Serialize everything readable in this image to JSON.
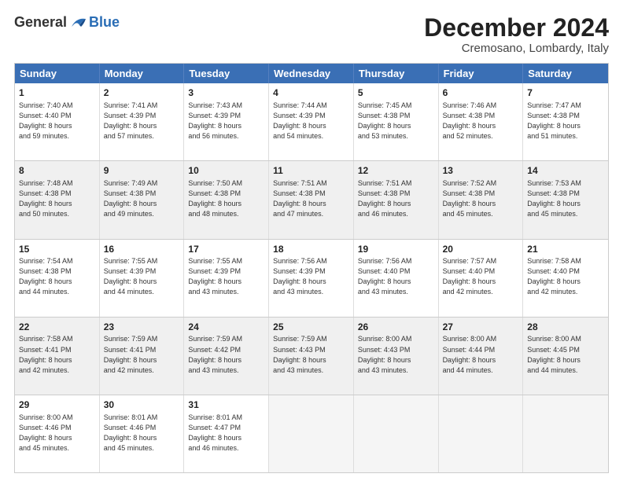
{
  "logo": {
    "general": "General",
    "blue": "Blue"
  },
  "title": "December 2024",
  "location": "Cremosano, Lombardy, Italy",
  "header_days": [
    "Sunday",
    "Monday",
    "Tuesday",
    "Wednesday",
    "Thursday",
    "Friday",
    "Saturday"
  ],
  "weeks": [
    [
      {
        "day": "1",
        "lines": [
          "Sunrise: 7:40 AM",
          "Sunset: 4:40 PM",
          "Daylight: 8 hours",
          "and 59 minutes."
        ],
        "shaded": false
      },
      {
        "day": "2",
        "lines": [
          "Sunrise: 7:41 AM",
          "Sunset: 4:39 PM",
          "Daylight: 8 hours",
          "and 57 minutes."
        ],
        "shaded": false
      },
      {
        "day": "3",
        "lines": [
          "Sunrise: 7:43 AM",
          "Sunset: 4:39 PM",
          "Daylight: 8 hours",
          "and 56 minutes."
        ],
        "shaded": false
      },
      {
        "day": "4",
        "lines": [
          "Sunrise: 7:44 AM",
          "Sunset: 4:39 PM",
          "Daylight: 8 hours",
          "and 54 minutes."
        ],
        "shaded": false
      },
      {
        "day": "5",
        "lines": [
          "Sunrise: 7:45 AM",
          "Sunset: 4:38 PM",
          "Daylight: 8 hours",
          "and 53 minutes."
        ],
        "shaded": false
      },
      {
        "day": "6",
        "lines": [
          "Sunrise: 7:46 AM",
          "Sunset: 4:38 PM",
          "Daylight: 8 hours",
          "and 52 minutes."
        ],
        "shaded": false
      },
      {
        "day": "7",
        "lines": [
          "Sunrise: 7:47 AM",
          "Sunset: 4:38 PM",
          "Daylight: 8 hours",
          "and 51 minutes."
        ],
        "shaded": false
      }
    ],
    [
      {
        "day": "8",
        "lines": [
          "Sunrise: 7:48 AM",
          "Sunset: 4:38 PM",
          "Daylight: 8 hours",
          "and 50 minutes."
        ],
        "shaded": true
      },
      {
        "day": "9",
        "lines": [
          "Sunrise: 7:49 AM",
          "Sunset: 4:38 PM",
          "Daylight: 8 hours",
          "and 49 minutes."
        ],
        "shaded": true
      },
      {
        "day": "10",
        "lines": [
          "Sunrise: 7:50 AM",
          "Sunset: 4:38 PM",
          "Daylight: 8 hours",
          "and 48 minutes."
        ],
        "shaded": true
      },
      {
        "day": "11",
        "lines": [
          "Sunrise: 7:51 AM",
          "Sunset: 4:38 PM",
          "Daylight: 8 hours",
          "and 47 minutes."
        ],
        "shaded": true
      },
      {
        "day": "12",
        "lines": [
          "Sunrise: 7:51 AM",
          "Sunset: 4:38 PM",
          "Daylight: 8 hours",
          "and 46 minutes."
        ],
        "shaded": true
      },
      {
        "day": "13",
        "lines": [
          "Sunrise: 7:52 AM",
          "Sunset: 4:38 PM",
          "Daylight: 8 hours",
          "and 45 minutes."
        ],
        "shaded": true
      },
      {
        "day": "14",
        "lines": [
          "Sunrise: 7:53 AM",
          "Sunset: 4:38 PM",
          "Daylight: 8 hours",
          "and 45 minutes."
        ],
        "shaded": true
      }
    ],
    [
      {
        "day": "15",
        "lines": [
          "Sunrise: 7:54 AM",
          "Sunset: 4:38 PM",
          "Daylight: 8 hours",
          "and 44 minutes."
        ],
        "shaded": false
      },
      {
        "day": "16",
        "lines": [
          "Sunrise: 7:55 AM",
          "Sunset: 4:39 PM",
          "Daylight: 8 hours",
          "and 44 minutes."
        ],
        "shaded": false
      },
      {
        "day": "17",
        "lines": [
          "Sunrise: 7:55 AM",
          "Sunset: 4:39 PM",
          "Daylight: 8 hours",
          "and 43 minutes."
        ],
        "shaded": false
      },
      {
        "day": "18",
        "lines": [
          "Sunrise: 7:56 AM",
          "Sunset: 4:39 PM",
          "Daylight: 8 hours",
          "and 43 minutes."
        ],
        "shaded": false
      },
      {
        "day": "19",
        "lines": [
          "Sunrise: 7:56 AM",
          "Sunset: 4:40 PM",
          "Daylight: 8 hours",
          "and 43 minutes."
        ],
        "shaded": false
      },
      {
        "day": "20",
        "lines": [
          "Sunrise: 7:57 AM",
          "Sunset: 4:40 PM",
          "Daylight: 8 hours",
          "and 42 minutes."
        ],
        "shaded": false
      },
      {
        "day": "21",
        "lines": [
          "Sunrise: 7:58 AM",
          "Sunset: 4:40 PM",
          "Daylight: 8 hours",
          "and 42 minutes."
        ],
        "shaded": false
      }
    ],
    [
      {
        "day": "22",
        "lines": [
          "Sunrise: 7:58 AM",
          "Sunset: 4:41 PM",
          "Daylight: 8 hours",
          "and 42 minutes."
        ],
        "shaded": true
      },
      {
        "day": "23",
        "lines": [
          "Sunrise: 7:59 AM",
          "Sunset: 4:41 PM",
          "Daylight: 8 hours",
          "and 42 minutes."
        ],
        "shaded": true
      },
      {
        "day": "24",
        "lines": [
          "Sunrise: 7:59 AM",
          "Sunset: 4:42 PM",
          "Daylight: 8 hours",
          "and 43 minutes."
        ],
        "shaded": true
      },
      {
        "day": "25",
        "lines": [
          "Sunrise: 7:59 AM",
          "Sunset: 4:43 PM",
          "Daylight: 8 hours",
          "and 43 minutes."
        ],
        "shaded": true
      },
      {
        "day": "26",
        "lines": [
          "Sunrise: 8:00 AM",
          "Sunset: 4:43 PM",
          "Daylight: 8 hours",
          "and 43 minutes."
        ],
        "shaded": true
      },
      {
        "day": "27",
        "lines": [
          "Sunrise: 8:00 AM",
          "Sunset: 4:44 PM",
          "Daylight: 8 hours",
          "and 44 minutes."
        ],
        "shaded": true
      },
      {
        "day": "28",
        "lines": [
          "Sunrise: 8:00 AM",
          "Sunset: 4:45 PM",
          "Daylight: 8 hours",
          "and 44 minutes."
        ],
        "shaded": true
      }
    ],
    [
      {
        "day": "29",
        "lines": [
          "Sunrise: 8:00 AM",
          "Sunset: 4:46 PM",
          "Daylight: 8 hours",
          "and 45 minutes."
        ],
        "shaded": false
      },
      {
        "day": "30",
        "lines": [
          "Sunrise: 8:01 AM",
          "Sunset: 4:46 PM",
          "Daylight: 8 hours",
          "and 45 minutes."
        ],
        "shaded": false
      },
      {
        "day": "31",
        "lines": [
          "Sunrise: 8:01 AM",
          "Sunset: 4:47 PM",
          "Daylight: 8 hours",
          "and 46 minutes."
        ],
        "shaded": false
      },
      {
        "day": "",
        "lines": [],
        "shaded": false,
        "empty": true
      },
      {
        "day": "",
        "lines": [],
        "shaded": false,
        "empty": true
      },
      {
        "day": "",
        "lines": [],
        "shaded": false,
        "empty": true
      },
      {
        "day": "",
        "lines": [],
        "shaded": false,
        "empty": true
      }
    ]
  ]
}
